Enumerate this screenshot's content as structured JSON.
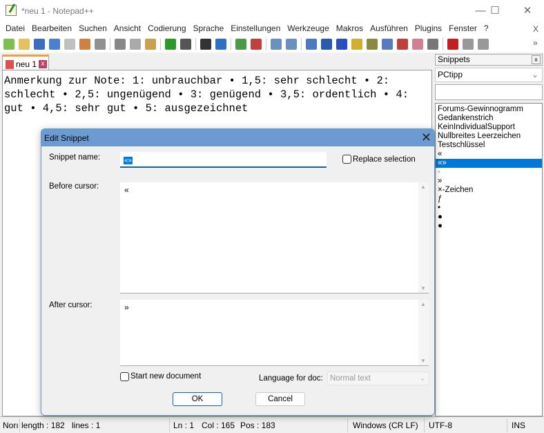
{
  "window": {
    "title": "*neu 1 - Notepad++",
    "minimize": "—",
    "maximize": "☐",
    "close": "✕"
  },
  "menu": [
    "Datei",
    "Bearbeiten",
    "Suchen",
    "Ansicht",
    "Codierung",
    "Sprache",
    "Einstellungen",
    "Werkzeuge",
    "Makros",
    "Ausführen",
    "Plugins",
    "Fenster",
    "?"
  ],
  "menu_close": "X",
  "toolbar": {
    "overflow": "»",
    "icons": [
      "new-file",
      "open-file",
      "save",
      "save-all",
      "close",
      "close-all",
      "print",
      "|",
      "cut",
      "copy",
      "paste",
      "|",
      "undo",
      "redo",
      "|",
      "find",
      "replace",
      "|",
      "zoom-in",
      "zoom-out",
      "|",
      "sync-v",
      "sync-h",
      "|",
      "word-wrap",
      "show-all-chars",
      "indent-guide",
      "udl",
      "doc-map",
      "doc-list",
      "function-list",
      "folder-workspace",
      "monitor",
      "|",
      "record-macro",
      "stop-macro",
      "play-macro"
    ]
  },
  "tab": {
    "label": "neu 1",
    "close": "x"
  },
  "editor": {
    "text": "Anmerkung zur Note: 1: unbrauchbar • 1,5: sehr schlecht • 2: schlecht • 2,5: ungenügend • 3: genügend • 3,5: ordentlich • 4: gut • 4,5: sehr gut • 5: ausgezeichnet"
  },
  "snippets": {
    "title": "Snippets",
    "close": "x",
    "library": "PCtipp",
    "items": [
      "Forums-Gewinnogramm",
      "Gedankenstrich",
      "KeinIndividualSupport",
      "Nullbreites Leerzeichen",
      "Testschlüssel",
      "«",
      "«»",
      "·",
      "»",
      "×-Zeichen",
      "ƒ",
      "•",
      "●",
      "●"
    ],
    "selected_index": 6
  },
  "dialog": {
    "title": "Edit Snippet",
    "close": "✕",
    "name_label": "Snippet name:",
    "name_value": "«»",
    "replace_label": "Replace selection",
    "before_label": "Before cursor:",
    "before_value": "«",
    "after_label": "After cursor:",
    "after_value": "»",
    "new_doc_label": "Start new document",
    "lang_label": "Language for doc:",
    "lang_value": "Normal text",
    "ok": "OK",
    "cancel": "Cancel"
  },
  "status": {
    "type": "Norı",
    "length": "length : 182",
    "lines": "lines : 1",
    "ln": "Ln : 1",
    "col": "Col : 165",
    "pos": "Pos : 183",
    "eol": "Windows (CR LF)",
    "enc": "UTF-8",
    "mode": "INS"
  }
}
